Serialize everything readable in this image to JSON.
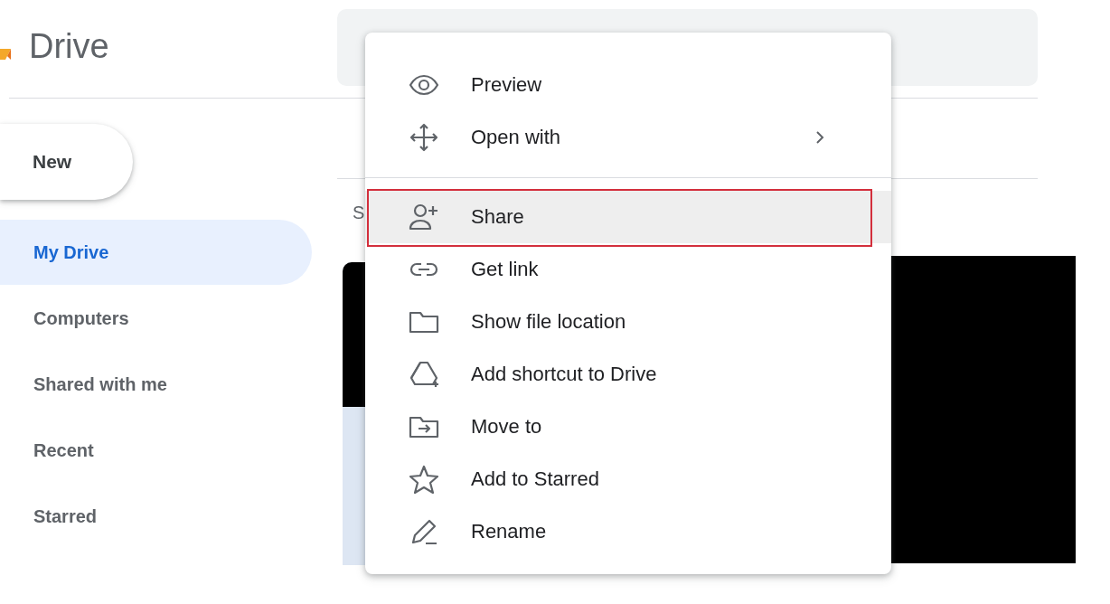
{
  "app": {
    "title": "Drive"
  },
  "new_button": {
    "label": "New"
  },
  "sidebar": {
    "items": [
      {
        "label": "My Drive",
        "selected": true
      },
      {
        "label": "Computers",
        "selected": false
      },
      {
        "label": "Shared with me",
        "selected": false
      },
      {
        "label": "Recent",
        "selected": false
      },
      {
        "label": "Starred",
        "selected": false
      }
    ]
  },
  "main": {
    "subheading": "S"
  },
  "context_menu": {
    "groups": [
      [
        {
          "label": "Preview",
          "submenu": false,
          "highlighted": false
        },
        {
          "label": "Open with",
          "submenu": true,
          "highlighted": false
        }
      ],
      [
        {
          "label": "Share",
          "submenu": false,
          "highlighted": true
        },
        {
          "label": "Get link",
          "submenu": false,
          "highlighted": false
        },
        {
          "label": "Show file location",
          "submenu": false,
          "highlighted": false
        },
        {
          "label": "Add shortcut to Drive",
          "submenu": false,
          "highlighted": false
        },
        {
          "label": "Move to",
          "submenu": false,
          "highlighted": false
        },
        {
          "label": "Add to Starred",
          "submenu": false,
          "highlighted": false
        },
        {
          "label": "Rename",
          "submenu": false,
          "highlighted": false
        }
      ]
    ]
  }
}
